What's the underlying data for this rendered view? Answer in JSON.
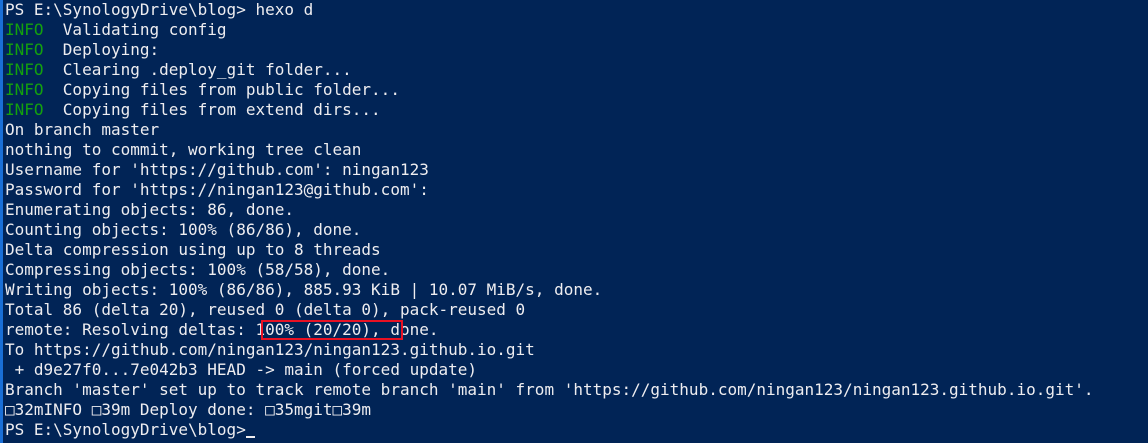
{
  "terminal": {
    "prompt1": "PS E:\\SynologyDrive\\blog> hexo d",
    "info_label": "INFO",
    "info_lines": [
      "  Validating config",
      "  Deploying:",
      "  Clearing .deploy_git folder...",
      "  Copying files from public folder...",
      "  Copying files from extend dirs..."
    ],
    "output_lines": [
      "On branch master",
      "nothing to commit, working tree clean",
      "Username for 'https://github.com': ningan123",
      "Password for 'https://ningan123@github.com':",
      "Enumerating objects: 86, done.",
      "Counting objects: 100% (86/86), done.",
      "Delta compression using up to 8 threads",
      "Compressing objects: 100% (58/58), done.",
      "Writing objects: 100% (86/86), 885.93 KiB | 10.07 MiB/s, done.",
      "Total 86 (delta 20), reused 0 (delta 0), pack-reused 0",
      "remote: Resolving deltas: 100% (20/20), done.",
      "To https://github.com/ningan123/ningan123.github.io.git",
      " + d9e27f0...7e042b3 HEAD -> main (forced update)",
      "Branch 'master' set up to track remote branch 'main' from 'https://github.com/ningan123/ningan123.github.io.git'.",
      "□32mINFO □39m Deploy done: □35mgit□39m"
    ],
    "prompt2": "PS E:\\SynologyDrive\\blog>"
  },
  "colors": {
    "background": "#012456",
    "text": "#eeedf0",
    "info": "#13a10e",
    "highlight_border": "#e81123"
  }
}
